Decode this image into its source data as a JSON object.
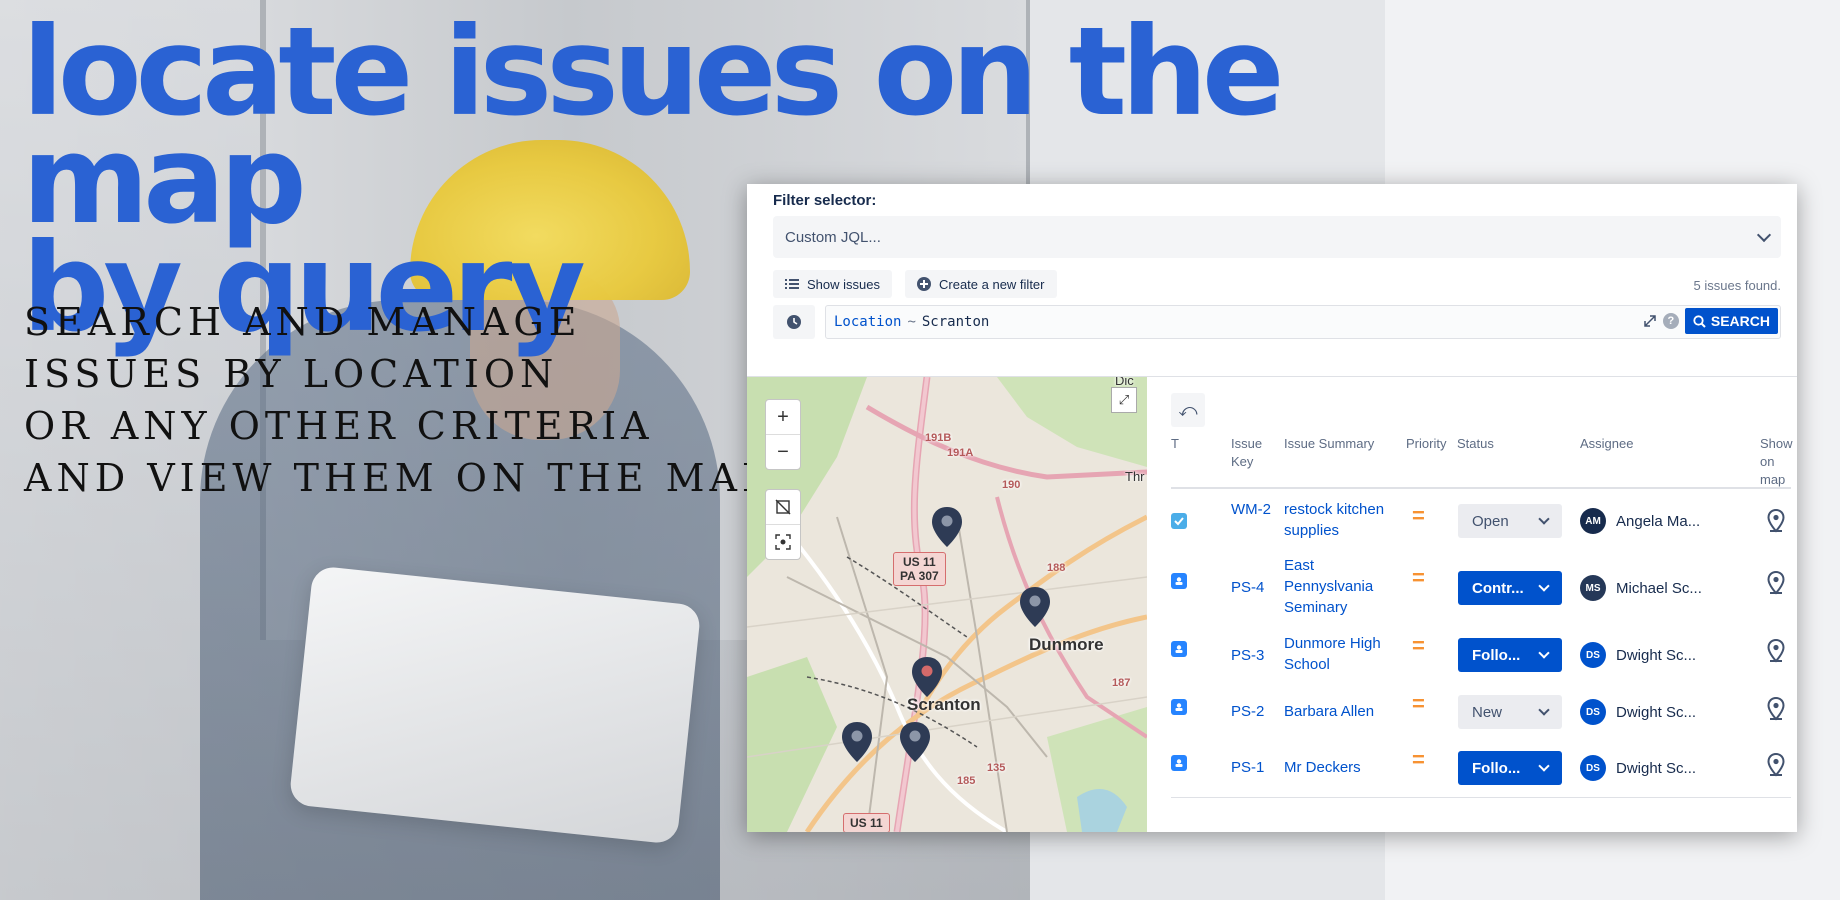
{
  "hero": {
    "headline_line1": "locate issues on the map",
    "headline_line2": "by query",
    "subhead_lines": [
      "SEARCH AND MANAGE",
      "ISSUES BY LOCATION",
      "OR ANY OTHER CRITERIA",
      "AND VIEW THEM ON THE MAP"
    ],
    "accent_color": "#2a62d3"
  },
  "app": {
    "filter_label": "Filter selector:",
    "filter_value": "Custom JQL...",
    "show_issues_label": "Show issues",
    "create_filter_label": "Create a new filter",
    "issues_found": "5 issues found.",
    "jql": {
      "field": "Location",
      "operator": "~",
      "value": "Scranton"
    },
    "search_label": "SEARCH",
    "help_label": "?"
  },
  "map": {
    "labels": {
      "dunmore": "Dunmore",
      "scranton": "Scranton",
      "road_190": "190",
      "road_188": "188",
      "road_187": "187",
      "road_185": "185",
      "road_135": "135",
      "road_191a": "191A",
      "road_191b": "191B",
      "thr": "Thr",
      "dic": "Dic"
    },
    "shields": {
      "us11_line1": "US 11",
      "us11_line2": "PA 307",
      "us11_bottom": "US 11"
    },
    "zoom_in": "+",
    "zoom_out": "−",
    "expand": "⤢"
  },
  "table": {
    "undo": "⤺",
    "headers": {
      "type": "T",
      "key": "Issue Key",
      "summary": "Issue Summary",
      "priority": "Priority",
      "status": "Status",
      "assignee": "Assignee",
      "show": "Show on map"
    },
    "rows": [
      {
        "key": "WM-2",
        "summary": "restock kitchen supplies",
        "priority": "=",
        "status": "Open",
        "status_style": "grey",
        "initials": "AM",
        "assignee": "Angela Ma...",
        "avatar_color": "#172b4d",
        "type_color": "#4bade8",
        "type": "task"
      },
      {
        "key": "PS-4",
        "summary": "East Pennyslvania Seminary",
        "priority": "=",
        "status": "Contr...",
        "status_style": "blue",
        "initials": "MS",
        "assignee": "Michael Sc...",
        "avatar_color": "#253858",
        "type_color": "#2684ff",
        "type": "location"
      },
      {
        "key": "PS-3",
        "summary": "Dunmore High School",
        "priority": "=",
        "status": "Follo...",
        "status_style": "blue",
        "initials": "DS",
        "assignee": "Dwight Sc...",
        "avatar_color": "#0052cc",
        "type_color": "#2684ff",
        "type": "location"
      },
      {
        "key": "PS-2",
        "summary": "Barbara Allen",
        "priority": "=",
        "status": "New",
        "status_style": "grey",
        "initials": "DS",
        "assignee": "Dwight Sc...",
        "avatar_color": "#0052cc",
        "type_color": "#2684ff",
        "type": "location"
      },
      {
        "key": "PS-1",
        "summary": "Mr Deckers",
        "priority": "=",
        "status": "Follo...",
        "status_style": "blue",
        "initials": "DS",
        "assignee": "Dwight Sc...",
        "avatar_color": "#0052cc",
        "type_color": "#2684ff",
        "type": "location"
      }
    ]
  }
}
